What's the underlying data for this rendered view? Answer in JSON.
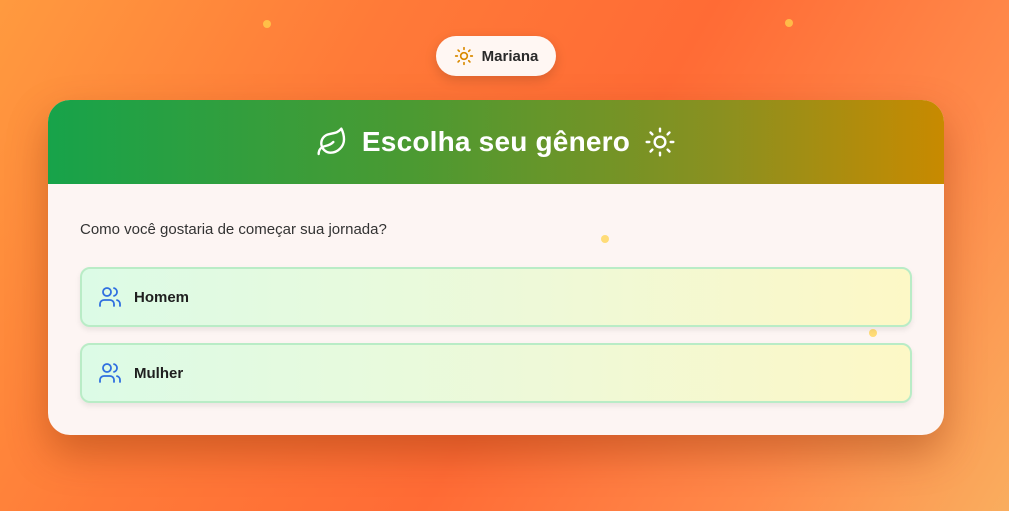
{
  "user": {
    "name": "Mariana",
    "icon": "sun-icon"
  },
  "card": {
    "title": "Escolha seu gênero",
    "title_left_icon": "leaf-icon",
    "title_right_icon": "sun-icon",
    "prompt": "Como você gostaria de começar sua jornada?",
    "options": [
      {
        "label": "Homem",
        "icon": "users-icon"
      },
      {
        "label": "Mulher",
        "icon": "users-icon"
      }
    ]
  },
  "colors": {
    "background_start": "#ff9a3f",
    "background_end": "#f9ad5e",
    "header_start": "#17a34a",
    "header_end": "#c88a00",
    "option_icon": "#2f6fe0",
    "sun_icon": "#d98a00"
  }
}
